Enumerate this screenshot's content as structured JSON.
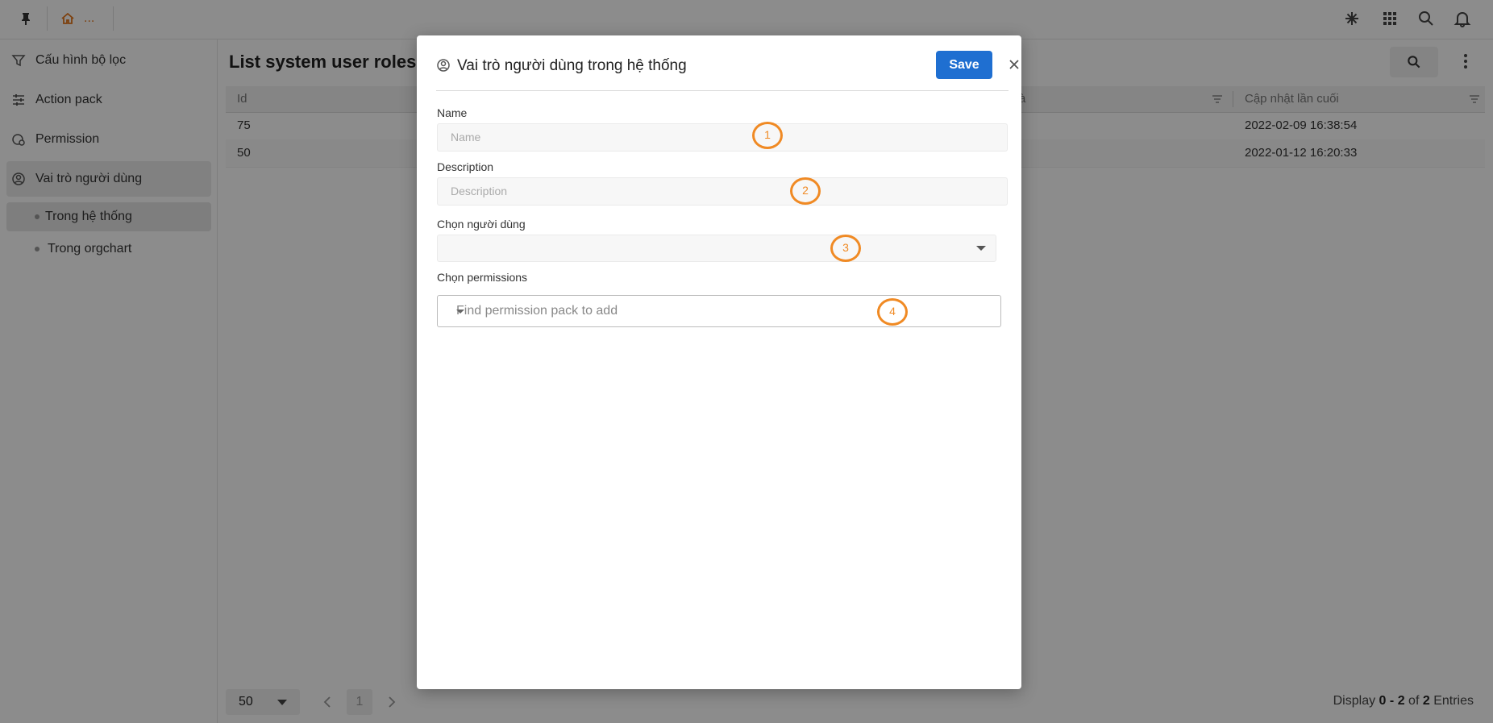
{
  "topbar": {
    "breadcrumb": "...",
    "icons": [
      "pin-icon",
      "home-icon",
      "asterisk-icon",
      "apps-grid-icon",
      "search-icon",
      "bell-icon"
    ]
  },
  "sidebar": {
    "items": [
      {
        "label": "Cấu hình bộ lọc",
        "icon": "filter-icon"
      },
      {
        "label": "Action pack",
        "icon": "sliders-icon"
      },
      {
        "label": "Permission",
        "icon": "permission-icon"
      },
      {
        "label": "Vai trò người dùng",
        "icon": "user-circle-icon"
      }
    ],
    "subitems": [
      {
        "label": "Trong hệ thống"
      },
      {
        "label": "Trong orgchart"
      }
    ]
  },
  "main": {
    "title": "List system user roles",
    "columns": [
      "Id",
      "à",
      "Cập nhật lần cuối"
    ],
    "rows": [
      {
        "id": "75",
        "updated": "2022-02-09 16:38:54"
      },
      {
        "id": "50",
        "updated": "2022-01-12 16:20:33"
      }
    ],
    "page_size": "50",
    "current_page": "1",
    "entries": {
      "prefix": "Display",
      "from": "0",
      "dash": "-",
      "to": "2",
      "of": "of",
      "total": "2",
      "suffix": "Entries"
    }
  },
  "modal": {
    "title": "Vai trò người dùng trong hệ thống",
    "save_label": "Save",
    "fields": {
      "name": {
        "label": "Name",
        "placeholder": "Name"
      },
      "description": {
        "label": "Description",
        "placeholder": "Description"
      },
      "users": {
        "label": "Chọn người dùng",
        "value": ""
      },
      "permissions": {
        "label": "Chọn permissions",
        "placeholder": "Find permission pack to add"
      }
    },
    "annotations": [
      "1",
      "2",
      "3",
      "4"
    ]
  },
  "colors": {
    "accent": "#1f6fd1",
    "annotation": "#f08a24",
    "breadcrumb": "#e4761b"
  }
}
